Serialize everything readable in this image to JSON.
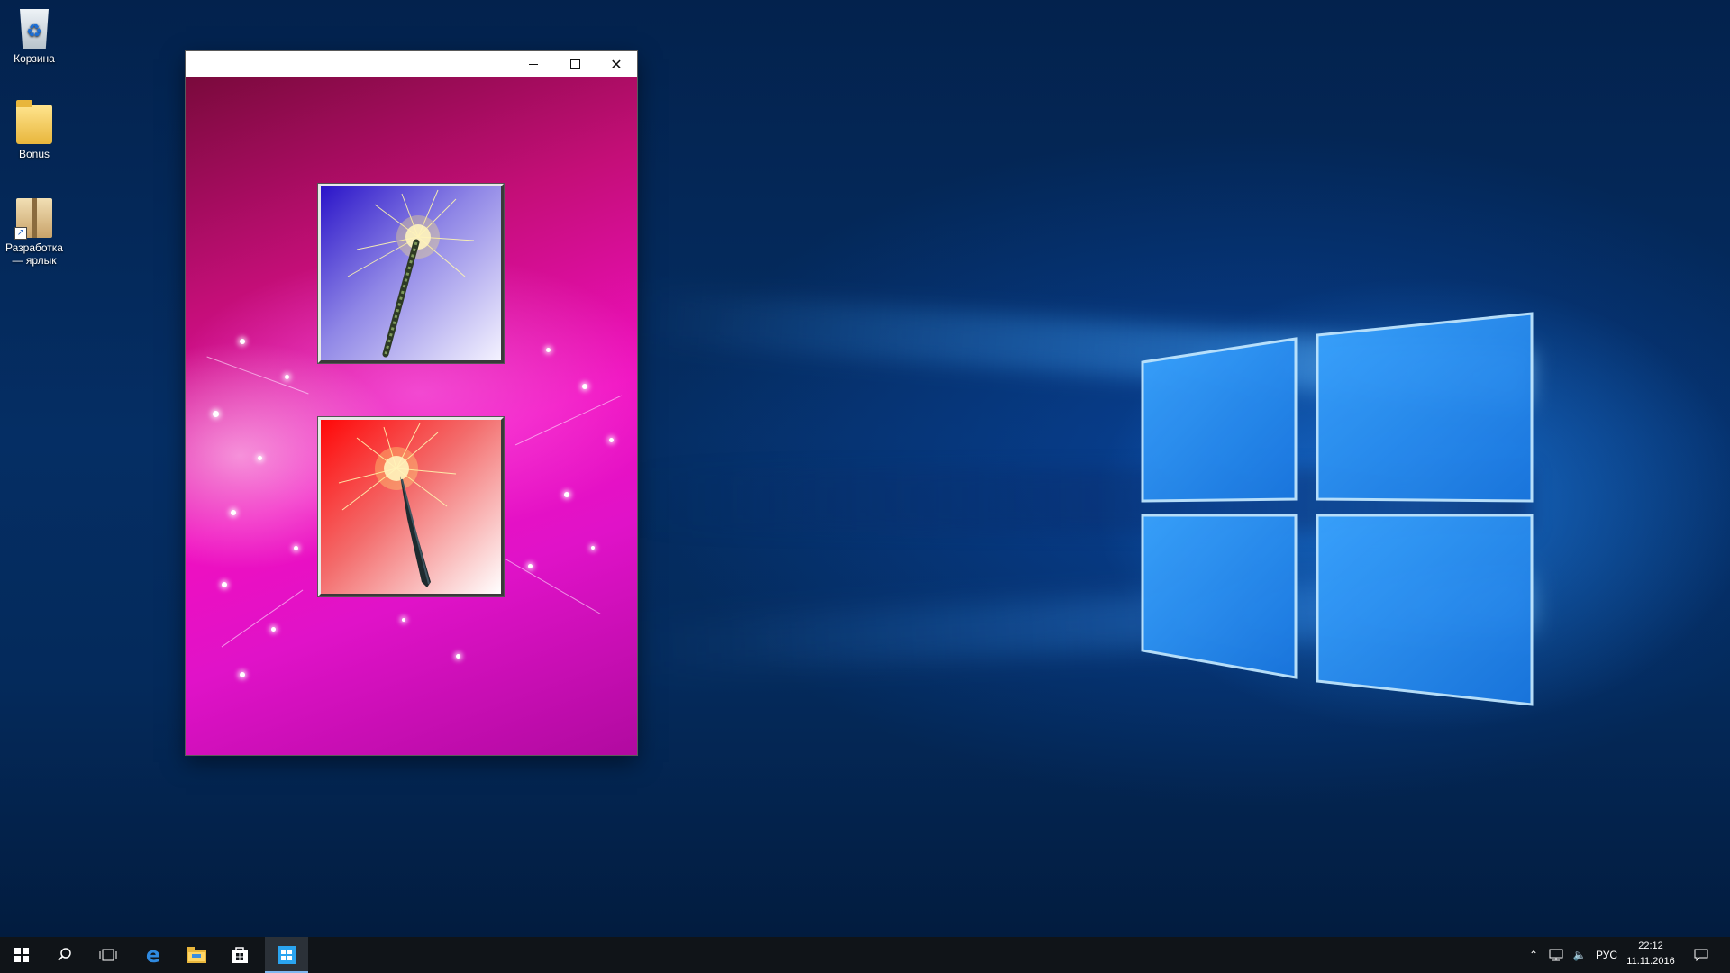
{
  "desktop": {
    "icons": [
      {
        "label": "Корзина"
      },
      {
        "label": "Bonus"
      },
      {
        "label": "Разработка — ярлык"
      }
    ]
  },
  "window": {
    "title": "",
    "controls": {
      "minimize": "minimize-icon",
      "maximize": "maximize-icon",
      "close": "close-icon"
    },
    "buttons": [
      {
        "name": "sparkler-blue-button",
        "color": "#2a14c8"
      },
      {
        "name": "sparkler-red-button",
        "color": "#ff0707"
      }
    ]
  },
  "taskbar": {
    "pinned": [
      "start-icon",
      "search-icon",
      "task-view-icon",
      "edge-icon",
      "file-explorer-icon",
      "store-icon",
      "app-icon"
    ],
    "tray": {
      "language": "РУС",
      "time": "22:12",
      "date": "11.11.2016"
    }
  },
  "colors": {
    "accent": "#7fb7f0",
    "taskbar": "#101418"
  }
}
